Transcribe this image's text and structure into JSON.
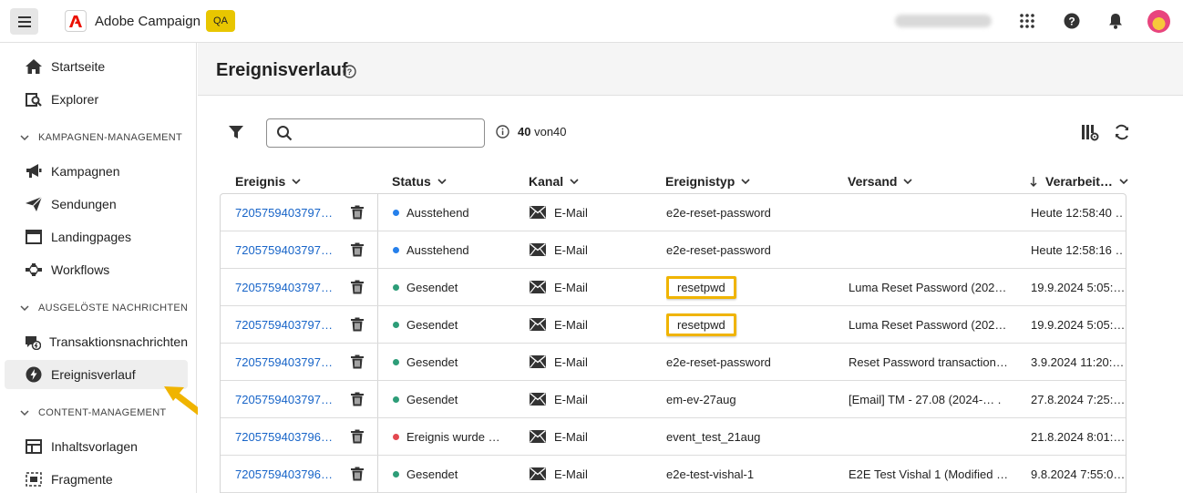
{
  "topbar": {
    "brand": "Adobe Campaign",
    "env_badge": "QA",
    "icons": [
      "menu-icon",
      "adobe-logo-icon",
      "apps-grid-icon",
      "help-icon",
      "bell-icon",
      "avatar"
    ]
  },
  "sidebar": {
    "items_top": [
      {
        "label": "Startseite",
        "icon": "home-icon"
      },
      {
        "label": "Explorer",
        "icon": "explorer-icon"
      }
    ],
    "sections": [
      {
        "title": "KAMPAGNEN-MANAGEMENT",
        "items": [
          {
            "label": "Kampagnen",
            "icon": "megaphone-icon"
          },
          {
            "label": "Sendungen",
            "icon": "send-icon"
          },
          {
            "label": "Landingpages",
            "icon": "landing-page-icon"
          },
          {
            "label": "Workflows",
            "icon": "workflow-icon"
          }
        ]
      },
      {
        "title": "AUSGELÖSTE NACHRICHTEN",
        "items": [
          {
            "label": "Transaktionsnachrichten",
            "icon": "transaction-message-icon"
          },
          {
            "label": "Ereignisverlauf",
            "icon": "lightning-icon",
            "active": true
          }
        ]
      },
      {
        "title": "CONTENT-MANAGEMENT",
        "items": [
          {
            "label": "Inhaltsvorlagen",
            "icon": "template-icon"
          },
          {
            "label": "Fragmente",
            "icon": "fragment-icon"
          }
        ]
      }
    ]
  },
  "main": {
    "title": "Ereignisverlauf",
    "search": {
      "value": "",
      "placeholder": ""
    },
    "count_current": "40",
    "count_rest": "von40",
    "columns": [
      "Ereignis",
      "Status",
      "Kanal",
      "Ereignistyp",
      "Versand",
      "Verarbeit…"
    ],
    "rows": [
      {
        "id": "7205759403797…",
        "status": "Ausstehend",
        "status_color": "#2680eb",
        "channel": "E-Mail",
        "type": "e2e-reset-password",
        "delivery": "",
        "processed": "Heute 12:58:40 …",
        "highlight": false
      },
      {
        "id": "7205759403797…",
        "status": "Ausstehend",
        "status_color": "#2680eb",
        "channel": "E-Mail",
        "type": "e2e-reset-password",
        "delivery": "",
        "processed": "Heute 12:58:16 …",
        "highlight": false
      },
      {
        "id": "7205759403797…",
        "status": "Gesendet",
        "status_color": "#2d9d78",
        "channel": "E-Mail",
        "type": "resetpwd",
        "delivery": "Luma Reset Password (202…",
        "processed": "19.9.2024  5:05:…",
        "highlight": true
      },
      {
        "id": "7205759403797…",
        "status": "Gesendet",
        "status_color": "#2d9d78",
        "channel": "E-Mail",
        "type": "resetpwd",
        "delivery": "Luma Reset Password (202…",
        "processed": "19.9.2024  5:05:…",
        "highlight": true
      },
      {
        "id": "7205759403797…",
        "status": "Gesendet",
        "status_color": "#2d9d78",
        "channel": "E-Mail",
        "type": "e2e-reset-password",
        "delivery": "Reset Password transaction…",
        "processed": "3.9.2024  11:20:…",
        "highlight": false
      },
      {
        "id": "7205759403797…",
        "status": "Gesendet",
        "status_color": "#2d9d78",
        "channel": "E-Mail",
        "type": "em-ev-27aug",
        "delivery": "[Email] TM - 27.08 (2024-… .",
        "processed": "27.8.2024  7:25:…",
        "highlight": false
      },
      {
        "id": "7205759403796…",
        "status": "Ereignis wurde …",
        "status_color": "#e34850",
        "channel": "E-Mail",
        "type": "event_test_21aug",
        "delivery": "",
        "processed": "21.8.2024  8:01:…",
        "highlight": false
      },
      {
        "id": "7205759403796…",
        "status": "Gesendet",
        "status_color": "#2d9d78",
        "channel": "E-Mail",
        "type": "e2e-test-vishal-1",
        "delivery": "E2E Test Vishal 1 (Modified …",
        "processed": "9.8.2024  7:55:0…",
        "highlight": false
      }
    ]
  },
  "colors": {
    "accent": "#1764c8",
    "highlight": "#f0b400",
    "qa_badge": "#e8c600"
  }
}
